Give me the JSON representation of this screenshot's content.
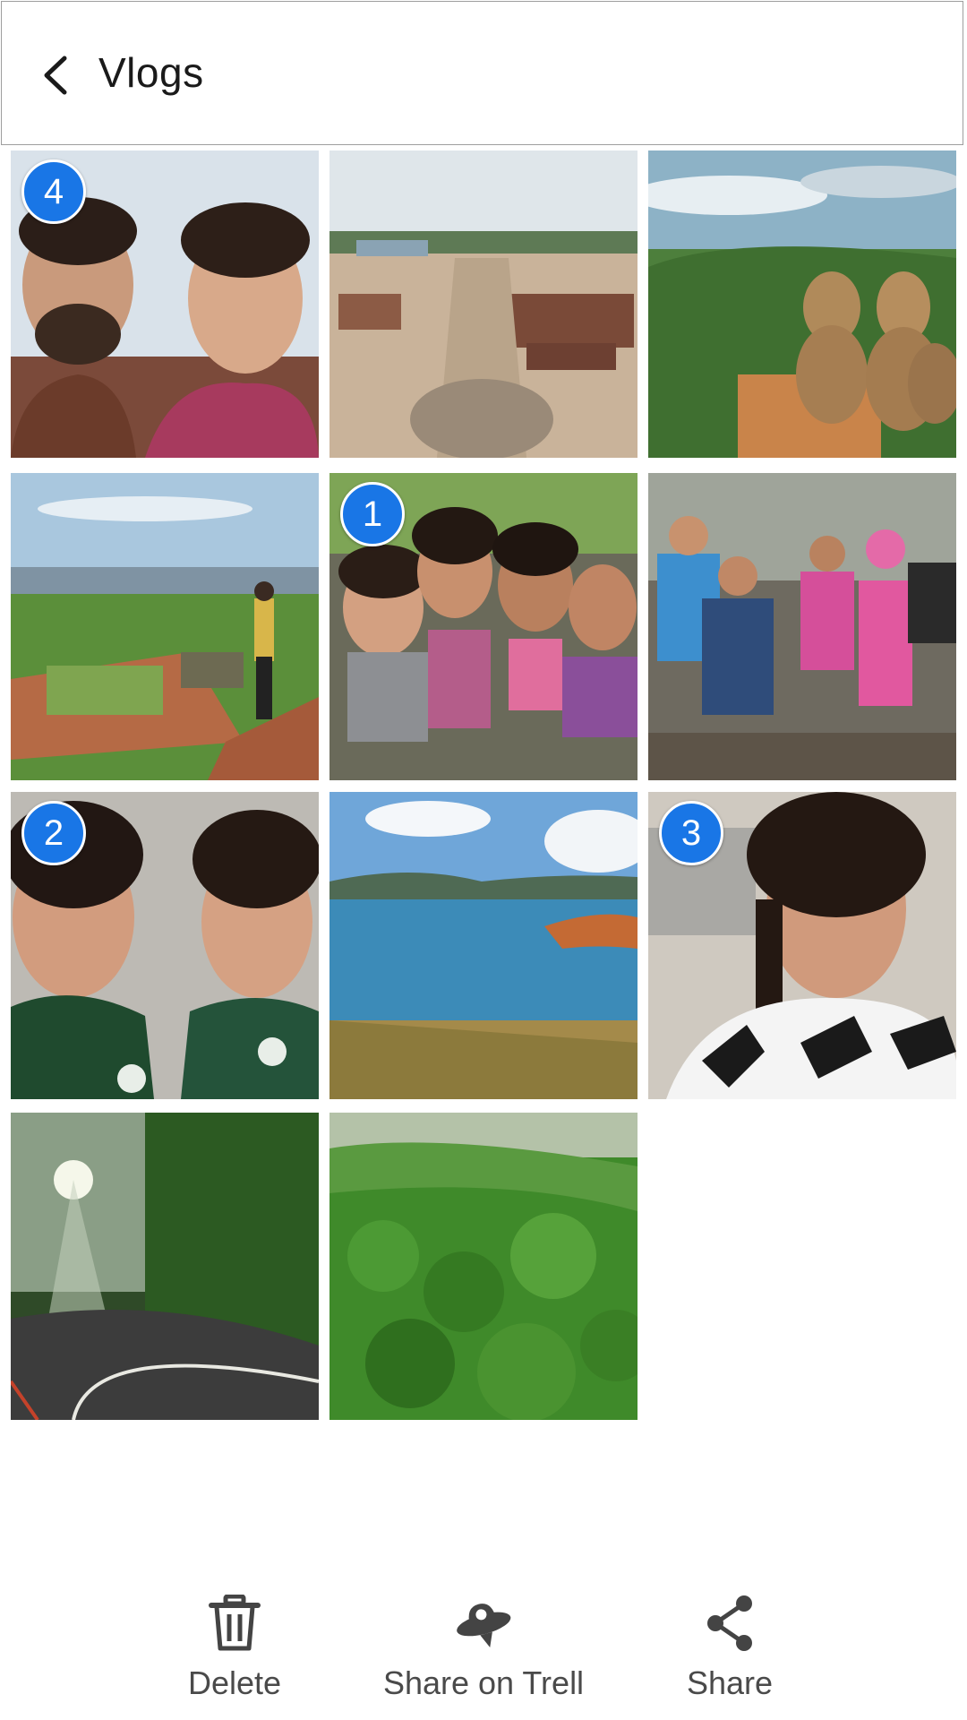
{
  "header": {
    "title": "Vlogs",
    "back_icon": "chevron-left-icon"
  },
  "grid": {
    "tiles": [
      {
        "scene": "selfie couple",
        "badge": "4"
      },
      {
        "scene": "temple ruins",
        "badge": ""
      },
      {
        "scene": "monkeys on ledge",
        "badge": ""
      },
      {
        "scene": "person overlooking ruins",
        "badge": ""
      },
      {
        "scene": "group selfie friends",
        "badge": "1"
      },
      {
        "scene": "hiking group",
        "badge": ""
      },
      {
        "scene": "two friends selfie",
        "badge": "2"
      },
      {
        "scene": "blue lake",
        "badge": ""
      },
      {
        "scene": "selfie woman",
        "badge": "3"
      },
      {
        "scene": "forest road with sunrays",
        "badge": ""
      },
      {
        "scene": "green forest hills",
        "badge": ""
      }
    ]
  },
  "actions": {
    "delete_label": "Delete",
    "delete_icon": "trash-icon",
    "trell_label": "Share on Trell",
    "trell_icon": "trell-ufo-icon",
    "share_label": "Share",
    "share_icon": "share-icon"
  },
  "colors": {
    "badge": "#1976e6",
    "icon": "#444444"
  }
}
